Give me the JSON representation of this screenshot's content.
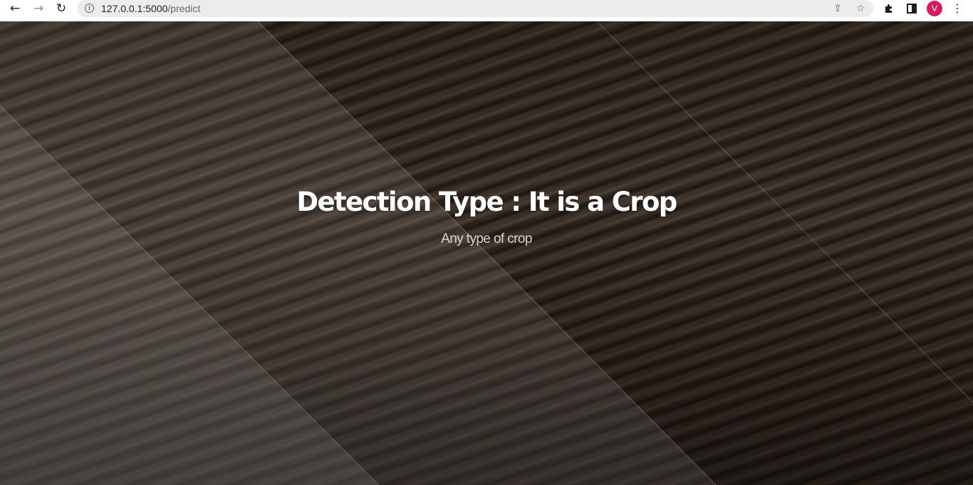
{
  "browser": {
    "url_host": "127.0.0.1:5000",
    "url_path": "/predict",
    "icons": {
      "back": "arrow-left-icon",
      "forward": "arrow-right-icon",
      "reload": "reload-icon",
      "site_info": "info-icon",
      "share": "share-icon",
      "bookmark": "star-icon",
      "extensions": "puzzle-icon",
      "side_panel": "side-panel-icon",
      "menu": "kebab-menu-icon"
    },
    "profile_initial": "V",
    "profile_color": "#d81b60"
  },
  "hero": {
    "title": "Detection Type : It is a Crop",
    "subtitle": "Any type of crop"
  }
}
